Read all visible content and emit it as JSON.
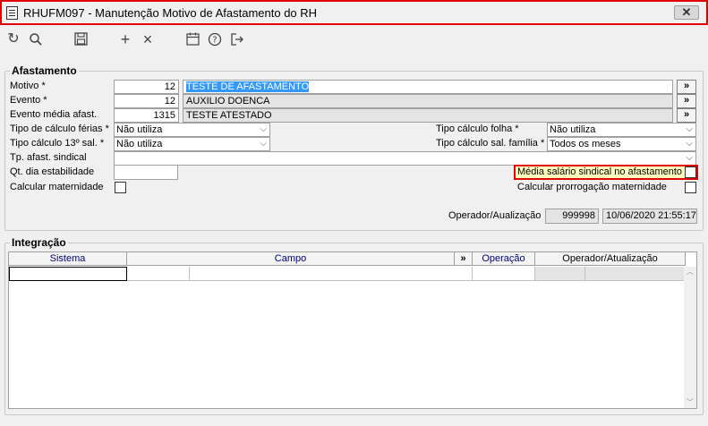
{
  "window": {
    "title": "RHUFM097 - Manutenção Motivo de Afastamento do RH",
    "close_label": "✕"
  },
  "toolbar": {
    "refresh_icon": "↻",
    "search_icon": "🔍",
    "save_icon": "💾",
    "add_icon": "+",
    "delete_icon": "×",
    "calendar_icon": "📅",
    "help_icon": "?",
    "exit_icon": "⇥"
  },
  "afastamento": {
    "title": "Afastamento",
    "motivo_label": "Motivo *",
    "motivo_code": "12",
    "motivo_desc": "TESTE DE AFASTAMENTO",
    "evento_label": "Evento *",
    "evento_code": "12",
    "evento_desc": "AUXILIO DOENCA",
    "evento_media_label": "Evento média afast.",
    "evento_media_code": "1315",
    "evento_media_desc": "TESTE ATESTADO",
    "more_label": "»",
    "tipo_ferias_label": "Tipo de cálculo férias *",
    "tipo_ferias_value": "Não utiliza",
    "tipo_13_label": "Tipo cálculo 13º sal. *",
    "tipo_13_value": "Não utiliza",
    "tp_sindical_label": "Tp. afast. sindical",
    "tp_sindical_value": "",
    "qt_estab_label": "Qt. dia estabilidade",
    "qt_estab_value": "",
    "calc_maternidade_label": "Calcular maternidade",
    "tipo_folha_label": "Tipo cálculo folha *",
    "tipo_folha_value": "Não utiliza",
    "tipo_familia_label": "Tipo cálculo sal. família *",
    "tipo_familia_value": "Todos os meses",
    "media_sindical_label": "Média salário sindical no afastamento",
    "calc_prorrogacao_label": "Calcular prorrogação maternidade",
    "operador_label": "Operador/Aualização",
    "operador_value": "999998",
    "atualizacao_value": "10/06/2020 21:55:17"
  },
  "integracao": {
    "title": "Integração",
    "columns": {
      "sistema": "Sistema",
      "campo": "Campo",
      "more": "»",
      "operacao": "Operação",
      "operador": "Operador/Atualização"
    }
  }
}
